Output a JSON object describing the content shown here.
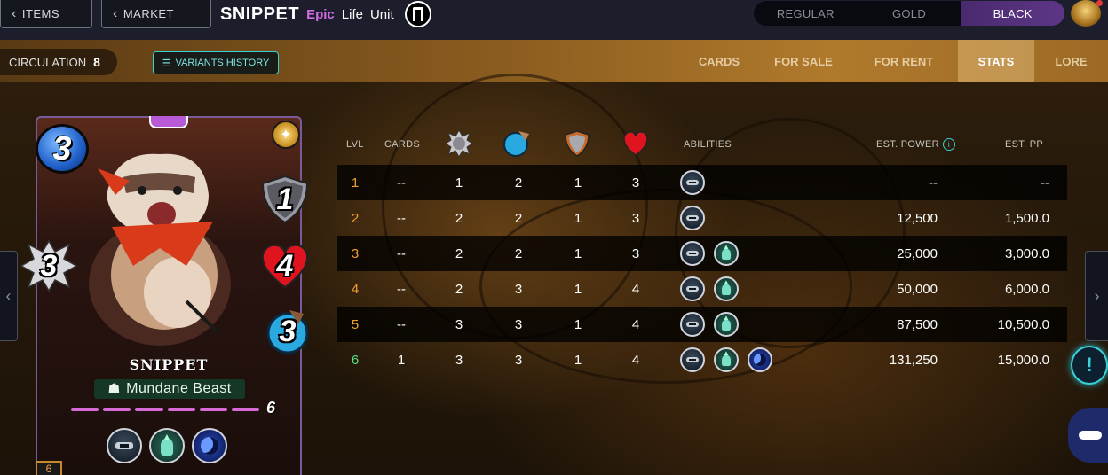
{
  "topbar": {
    "items_label": "ITEMS",
    "market_label": "MARKET",
    "card_name": "SNIPPET",
    "rarity": "Epic",
    "element": "Life",
    "type": "Unit",
    "editions": [
      "REGULAR",
      "GOLD",
      "BLACK"
    ],
    "active_edition": "BLACK"
  },
  "subbar": {
    "circulation_label": "CIRCULATION",
    "circulation_value": "8",
    "variants_label": "VARIANTS HISTORY",
    "tabs": [
      "CARDS",
      "FOR SALE",
      "FOR RENT",
      "STATS",
      "LORE"
    ],
    "active_tab": "STATS"
  },
  "card": {
    "mana": "3",
    "armor": "1",
    "health": "4",
    "speed": "3",
    "melee": "3",
    "name": "SNIPPET",
    "type_line": "Mundane Beast",
    "level": "6",
    "level_badge": "6",
    "abilities": [
      "ninja-icon",
      "tank-icon",
      "moon-icon"
    ]
  },
  "stats_table": {
    "headers": {
      "lvl": "LVL",
      "cards": "CARDS",
      "melee_icon": "melee-attack-icon",
      "speed_icon": "speed-icon",
      "armor_icon": "armor-icon",
      "health_icon": "health-icon",
      "abilities": "ABILITIES",
      "est_power": "EST. POWER",
      "est_pp": "EST. PP"
    },
    "rows": [
      {
        "lvl": "1",
        "cards": "--",
        "melee": "1",
        "speed": "2",
        "armor": "1",
        "health": "3",
        "abilities": [
          "ninja-icon"
        ],
        "est_power": "--",
        "est_pp": "--"
      },
      {
        "lvl": "2",
        "cards": "--",
        "melee": "2",
        "speed": "2",
        "armor": "1",
        "health": "3",
        "abilities": [
          "ninja-icon"
        ],
        "est_power": "12,500",
        "est_pp": "1,500.0"
      },
      {
        "lvl": "3",
        "cards": "--",
        "melee": "2",
        "speed": "2",
        "armor": "1",
        "health": "3",
        "abilities": [
          "ninja-icon",
          "tank-icon"
        ],
        "est_power": "25,000",
        "est_pp": "3,000.0"
      },
      {
        "lvl": "4",
        "cards": "--",
        "melee": "2",
        "speed": "3",
        "armor": "1",
        "health": "4",
        "abilities": [
          "ninja-icon",
          "tank-icon"
        ],
        "est_power": "50,000",
        "est_pp": "6,000.0"
      },
      {
        "lvl": "5",
        "cards": "--",
        "melee": "3",
        "speed": "3",
        "armor": "1",
        "health": "4",
        "abilities": [
          "ninja-icon",
          "tank-icon"
        ],
        "est_power": "87,500",
        "est_pp": "10,500.0"
      },
      {
        "lvl": "6",
        "cards": "1",
        "melee": "3",
        "speed": "3",
        "armor": "1",
        "health": "4",
        "abilities": [
          "ninja-icon",
          "tank-icon",
          "moon-icon"
        ],
        "est_power": "131,250",
        "est_pp": "15,000.0"
      }
    ]
  },
  "colors": {
    "rarity_epic": "#d26ae6",
    "accent_cyan": "#3ad0d8",
    "level_orange": "#f0a030",
    "level_green": "#5ae08a",
    "edition_active": "#5d3687"
  }
}
